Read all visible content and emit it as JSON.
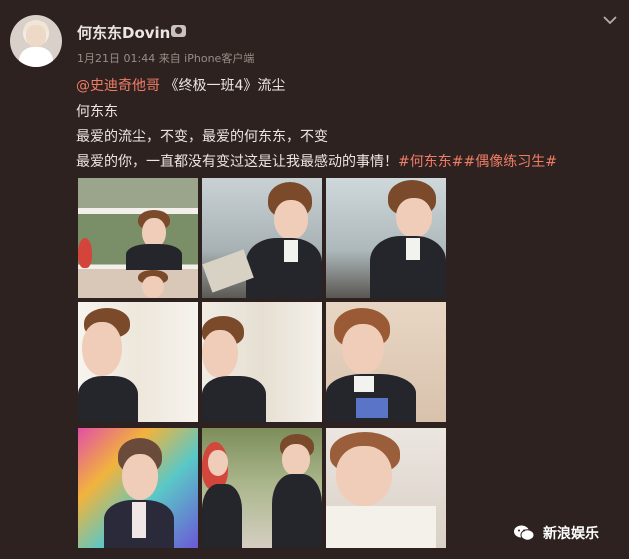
{
  "post": {
    "username": "何东东Dovin",
    "meta": "1月21日 01:44 来自 iPhone客户端",
    "line1_mention": "@史迪奇他哥",
    "line1_rest": " 《终极一班4》流尘",
    "line2": "何东东",
    "line3": "最爱的流尘，不变，最爱的何东东，不变",
    "line4_text": "最爱的你，一直都没有变过这是让我最感动的事情！",
    "line4_tags": "#何东东##偶像练习生#"
  },
  "icons": {
    "verified": "verified-badge-icon",
    "more": "chevron-down-icon",
    "wechat": "wechat-icon"
  },
  "watermark": {
    "text": "新浪娱乐"
  },
  "colors": {
    "background": "#2e2220",
    "link": "#f07c66"
  }
}
